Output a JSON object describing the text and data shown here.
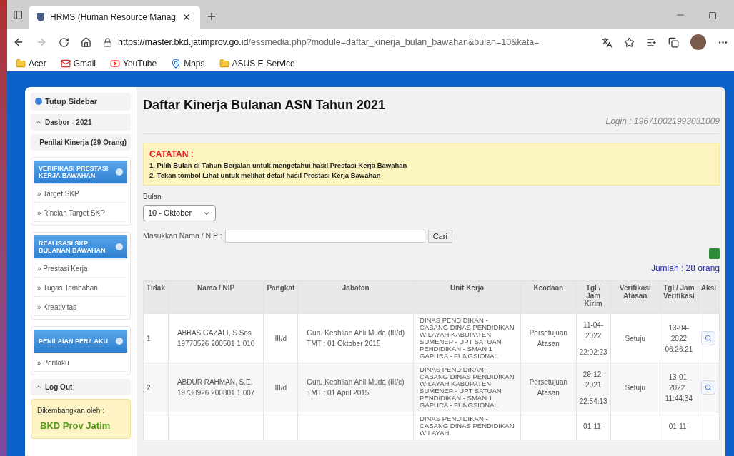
{
  "browser": {
    "tab_title": "HRMS (Human Resource Manag",
    "url_host": "https://master.bkd.jatimprov.go.id",
    "url_path": "/essmedia.php?module=daftar_kinerja_bulan_bawahan&bulan=10&kata=",
    "bookmarks": [
      {
        "label": "Acer",
        "kind": "folder"
      },
      {
        "label": "Gmail",
        "kind": "gmail"
      },
      {
        "label": "YouTube",
        "kind": "youtube"
      },
      {
        "label": "Maps",
        "kind": "maps"
      },
      {
        "label": "ASUS E-Service",
        "kind": "folder"
      }
    ]
  },
  "sidebar": [
    {
      "kind": "toggle",
      "label": "Tutup Sidebar"
    },
    {
      "kind": "header",
      "label": "Dasbor - 2021"
    },
    {
      "kind": "header",
      "label": "Penilai Kinerja (29 Orang)"
    },
    {
      "kind": "panel",
      "title": "VERIFIKASI PRESTASI KERJA BAWAHAN",
      "links": [
        "» Target SKP",
        "» Rincian Target SKP"
      ]
    },
    {
      "kind": "panel",
      "title": "REALISASI SKP BULANAN BAWAHAN",
      "links": [
        "» Prestasi Kerja",
        "» Tugas Tambahan",
        "» Kreativitas"
      ]
    },
    {
      "kind": "panel",
      "title": "PENILAIAN PERILAKU",
      "links": [
        "» Perilaku"
      ]
    },
    {
      "kind": "header",
      "label": "Log Out"
    },
    {
      "kind": "credit",
      "label": "Dikembangkan oleh :",
      "org": "BKD Prov Jatim"
    }
  ],
  "main": {
    "title": "Daftar Kinerja Bulanan ASN Tahun 2021",
    "login": "Login : 196710021993031009",
    "note": {
      "heading": "CATATAN :",
      "lines": [
        "1. Pilih Bulan di Tahun Berjalan untuk mengetahui hasil Prestasi Kerja Bawahan",
        "2. Tekan tombol Lihat untuk melihat detail hasil Prestasi Kerja Bawahan"
      ]
    },
    "month_label": "Bulan",
    "month_value": "10 - Oktober",
    "search_label": "Masukkan Nama / NIP :",
    "search_button": "Cari",
    "total": "Jumlah : 28 orang",
    "table": {
      "columns": [
        "Tidak",
        "Nama / NIP",
        "Pangkat",
        "Jabatan",
        "Unit Kerja",
        "Keadaan",
        "Tgl / Jam Kirim",
        "Verifikasi Atasan",
        "Tgl / Jam Verifikasi",
        "Aksi"
      ],
      "rows": [
        {
          "no": "1",
          "name": "ABBAS GAZALI, S.Sos",
          "nip": "19770526 200501 1 010",
          "rank": "III/d",
          "position": "Guru Keahlian Ahli Muda (III/d)",
          "tmt": "TMT : 01 Oktober 2015",
          "unit": "DINAS PENDIDIKAN - CABANG DINAS PENDIDIKAN WILAYAH KABUPATEN SUMENEP - UPT SATUAN PENDIDIKAN - SMAN 1 GAPURA - FUNGSIONAL",
          "status": "Persetujuan Atasan",
          "sent_date": "11-04-2022",
          "sent_time": "22:02:23",
          "verification": "Setuju",
          "verified_at": "13-04-2022 06:26:21"
        },
        {
          "no": "2",
          "name": "ABDUR RAHMAN, S.E.",
          "nip": "19730926 200801 1 007",
          "rank": "III/d",
          "position": "Guru Keahlian Ahli Muda (III/c)",
          "tmt": "TMT : 01 April 2015",
          "unit": "DINAS PENDIDIKAN - CABANG DINAS PENDIDIKAN WILAYAH KABUPATEN SUMENEP - UPT SATUAN PENDIDIKAN - SMAN 1 GAPURA - FUNGSIONAL",
          "status": "Persetujuan Atasan",
          "sent_date": "29-12-2021",
          "sent_time": "22:54:13",
          "verification": "Setuju",
          "verified_at": "13-01-2022 , 11:44:34"
        },
        {
          "unit": "DINAS PENDIDIKAN - CABANG DINAS PENDIDIKAN WILAYAH",
          "sent_date": "01-11-",
          "verified_at": "01-11-"
        }
      ]
    }
  }
}
